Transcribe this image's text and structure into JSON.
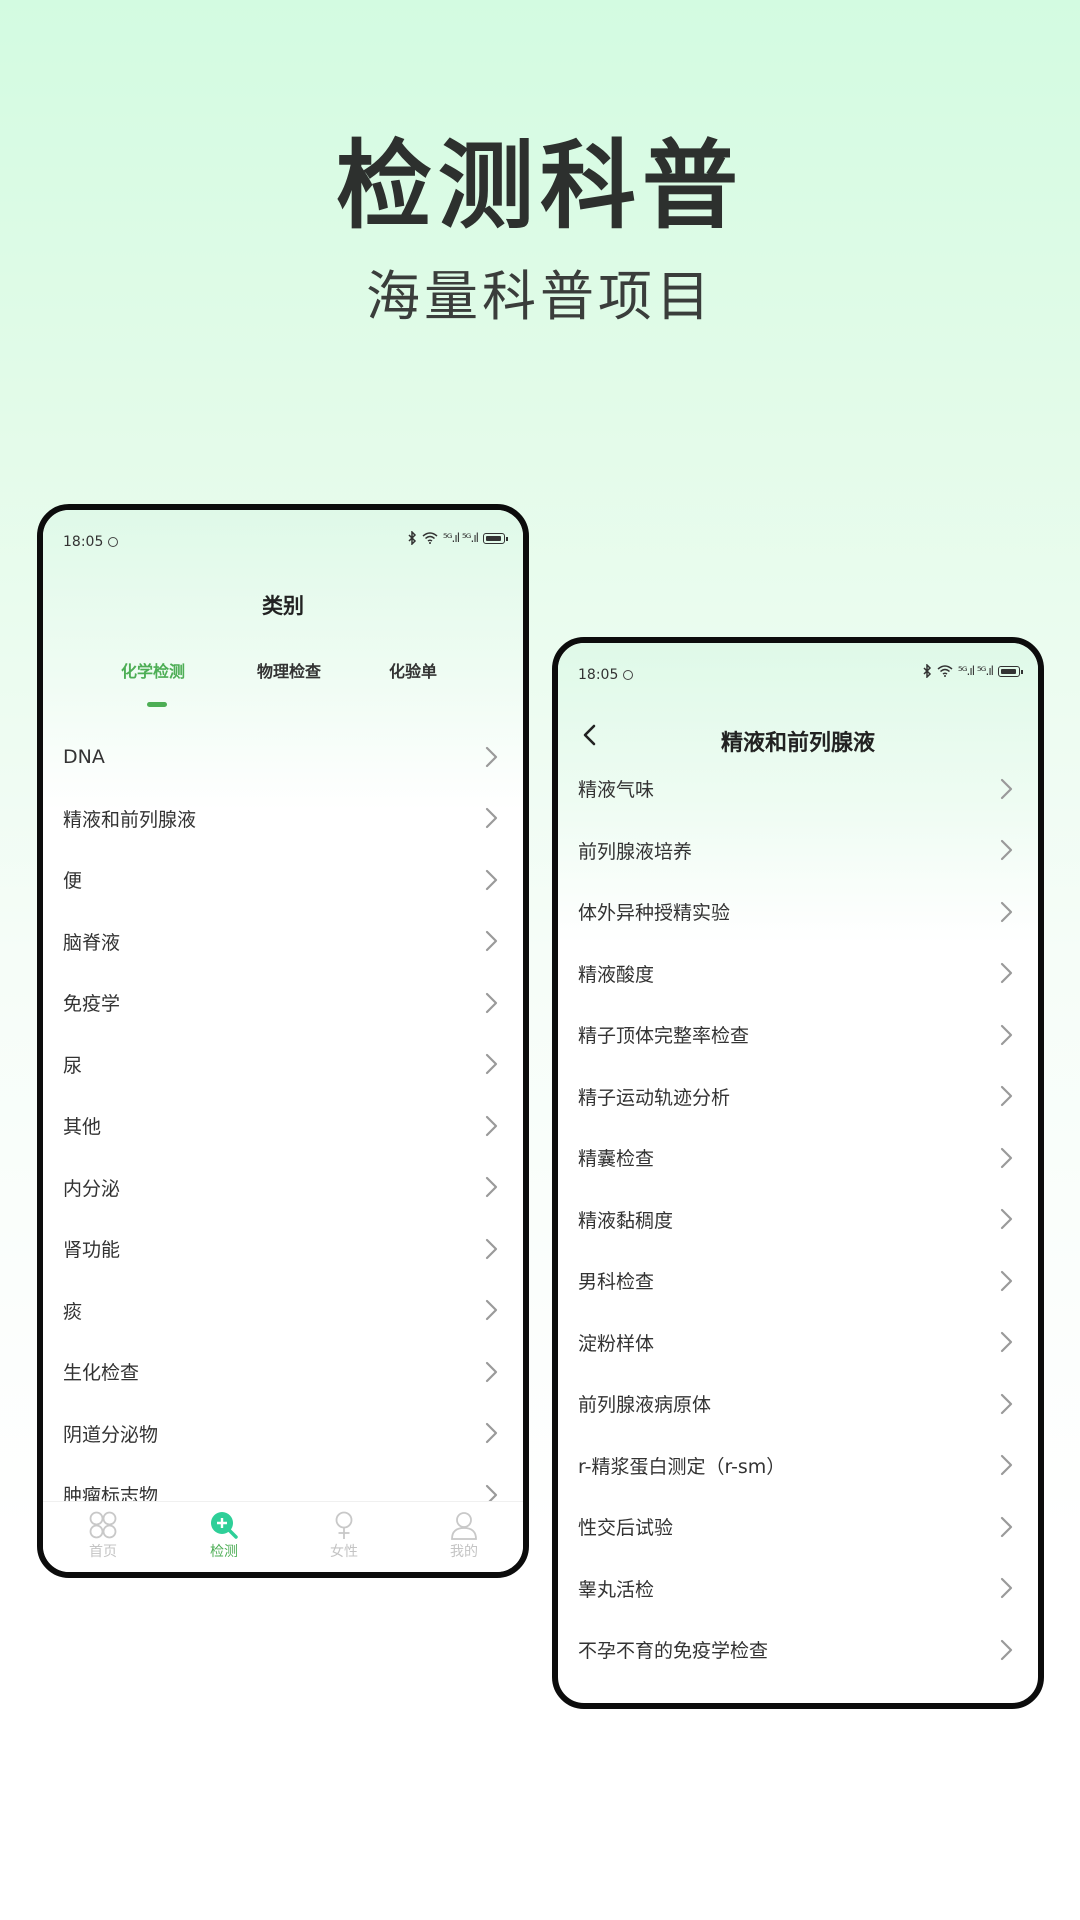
{
  "hero": {
    "title": "检测科普",
    "subtitle": "海量科普项目"
  },
  "left_screen": {
    "status": {
      "time": "18:05",
      "signal_text": "⁵ᴳ.ıl ⁵ᴳ.ıl"
    },
    "title": "类别",
    "tabs": [
      {
        "label": "化学检测",
        "active": true
      },
      {
        "label": "物理检查",
        "active": false
      },
      {
        "label": "化验单",
        "active": false
      }
    ],
    "items": [
      "DNA",
      "精液和前列腺液",
      "便",
      "脑脊液",
      "免疫学",
      "尿",
      "其他",
      "内分泌",
      "肾功能",
      "痰",
      "生化检查",
      "阴道分泌物",
      "肿瘤标志物"
    ],
    "tabbar": [
      {
        "label": "首页",
        "icon": "home-grid-icon",
        "active": false
      },
      {
        "label": "检测",
        "icon": "search-plus-icon",
        "active": true
      },
      {
        "label": "女性",
        "icon": "female-icon",
        "active": false
      },
      {
        "label": "我的",
        "icon": "user-icon",
        "active": false
      }
    ]
  },
  "right_screen": {
    "status": {
      "time": "18:05",
      "signal_text": "⁵ᴳ.ıl ⁵ᴳ.ıl"
    },
    "title": "精液和前列腺液",
    "items": [
      "精液气味",
      "前列腺液培养",
      "体外异种授精实验",
      "精液酸度",
      "精子顶体完整率检查",
      "精子运动轨迹分析",
      "精囊检查",
      "精液黏稠度",
      "男科检查",
      "淀粉样体",
      "前列腺液病原体",
      "r-精浆蛋白测定（r-sm）",
      "性交后试验",
      "睾丸活检",
      "不孕不育的免疫学检查"
    ]
  },
  "colors": {
    "accent": "#4dae55",
    "accent_icon": "#2ecf98",
    "text": "#333333",
    "inactive": "#c4c4c4"
  }
}
